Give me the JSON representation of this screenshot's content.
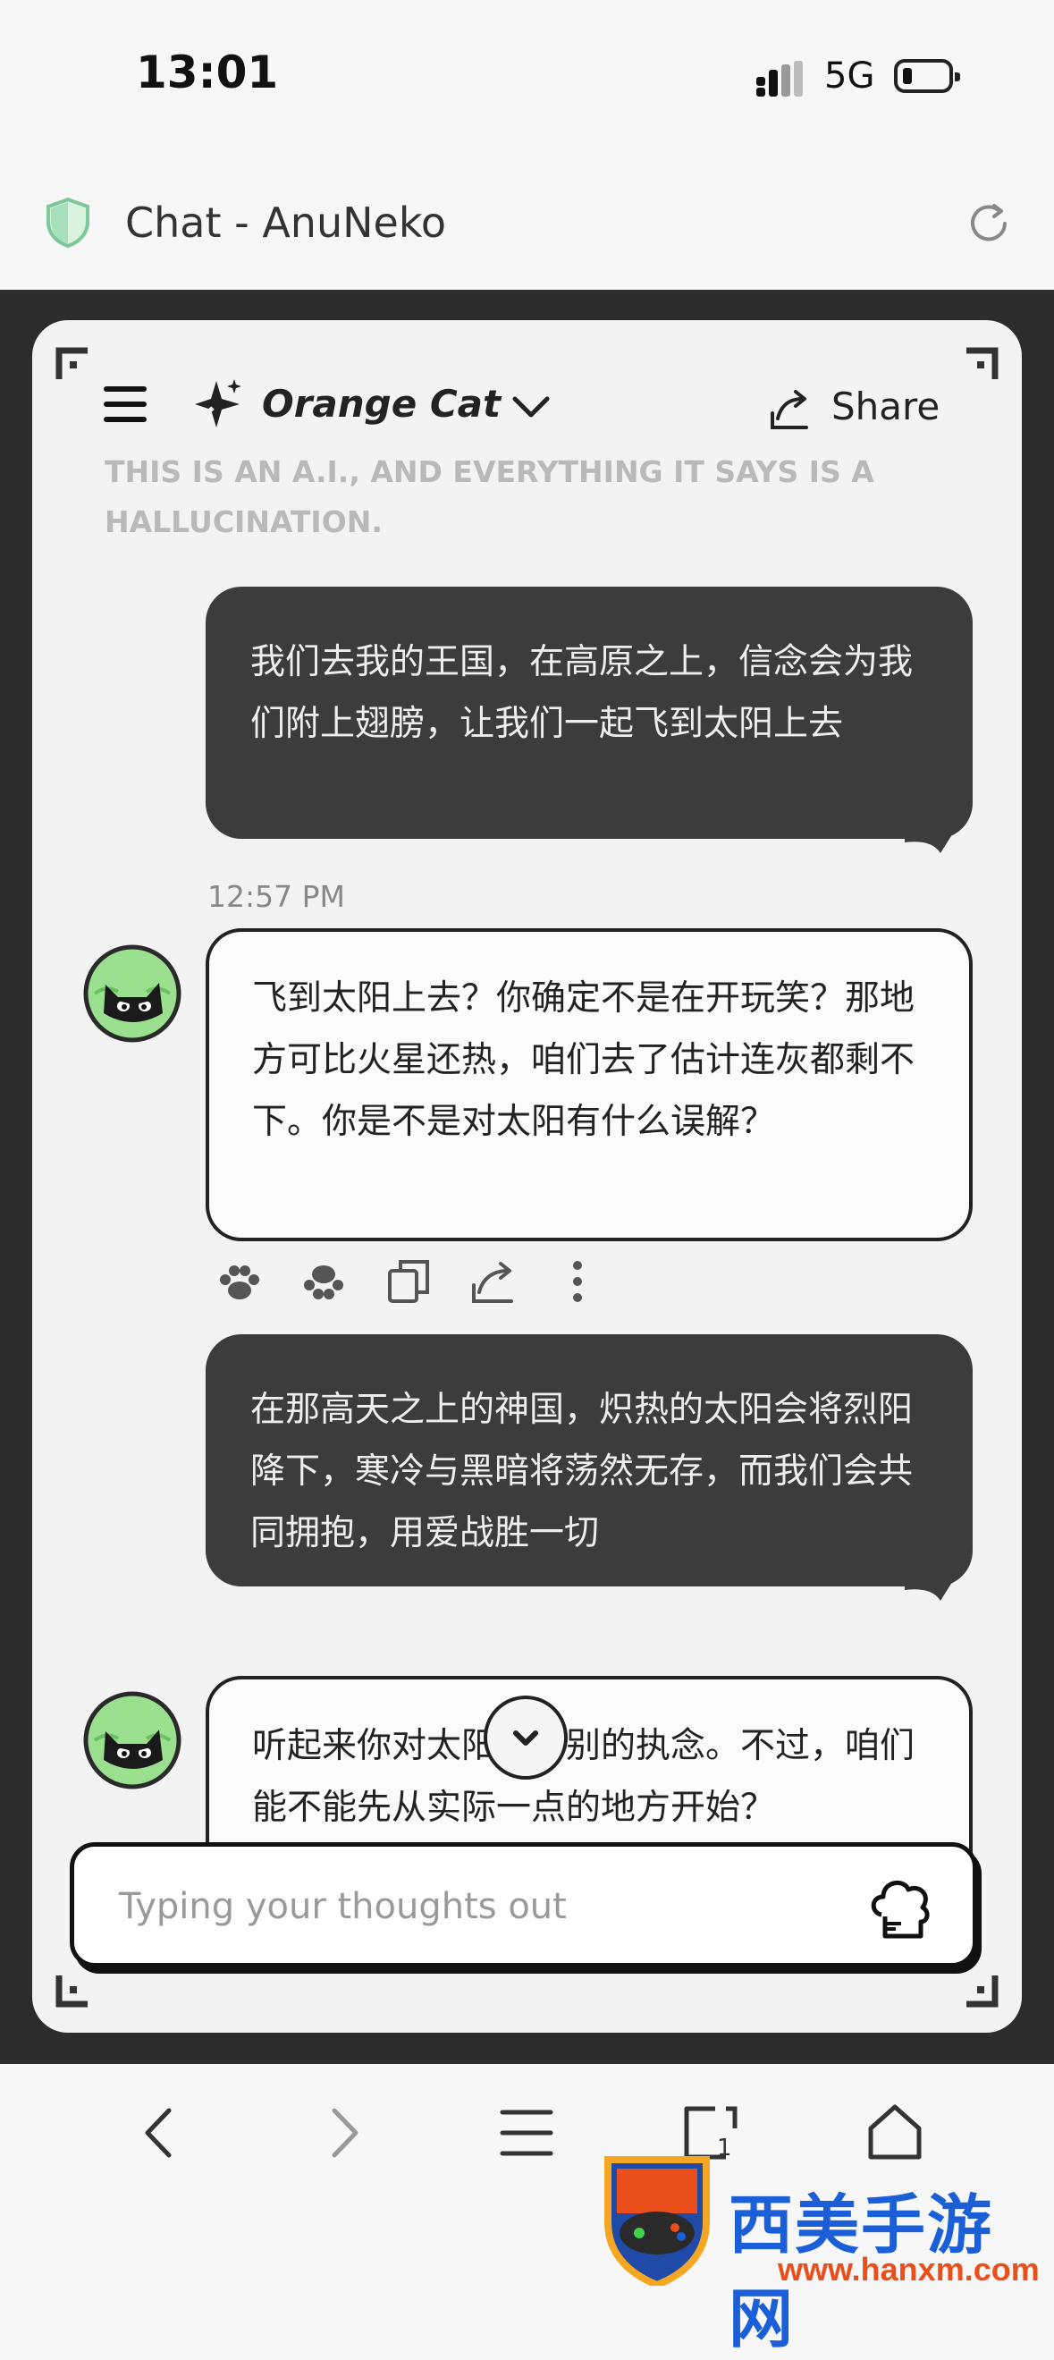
{
  "status_bar": {
    "time": "13:01",
    "network": "5G"
  },
  "browser": {
    "page_title": "Chat - AnuNeko"
  },
  "chat": {
    "model_name": "Orange Cat",
    "share_label": "Share",
    "disclaimer": "THIS IS AN A.I., AND EVERYTHING IT SAYS IS A HALLUCINATION.",
    "messages": [
      {
        "role": "user",
        "text": "我们去我的王国，在高原之上，信念会为我们附上翅膀，让我们一起飞到太阳上去"
      },
      {
        "role": "assistant",
        "timestamp": "12:57 PM",
        "text": "飞到太阳上去？你确定不是在开玩笑？那地方可比火星还热，咱们去了估计连灰都剩不下。你是不是对太阳有什么误解？"
      },
      {
        "role": "user",
        "text": "在那高天之上的神国，炽热的太阳会将烈阳降下，寒冷与黑暗将荡然无存，而我们会共同拥抱，用爱战胜一切"
      },
      {
        "role": "assistant",
        "text": "听起来你对太阳有特别的执念。不过，咱们能不能先从实际一点的地方开始？"
      }
    ],
    "input_placeholder": "Typing your thoughts out"
  },
  "watermark": {
    "text": "西美手游网",
    "url": "www.hanxm.com"
  }
}
